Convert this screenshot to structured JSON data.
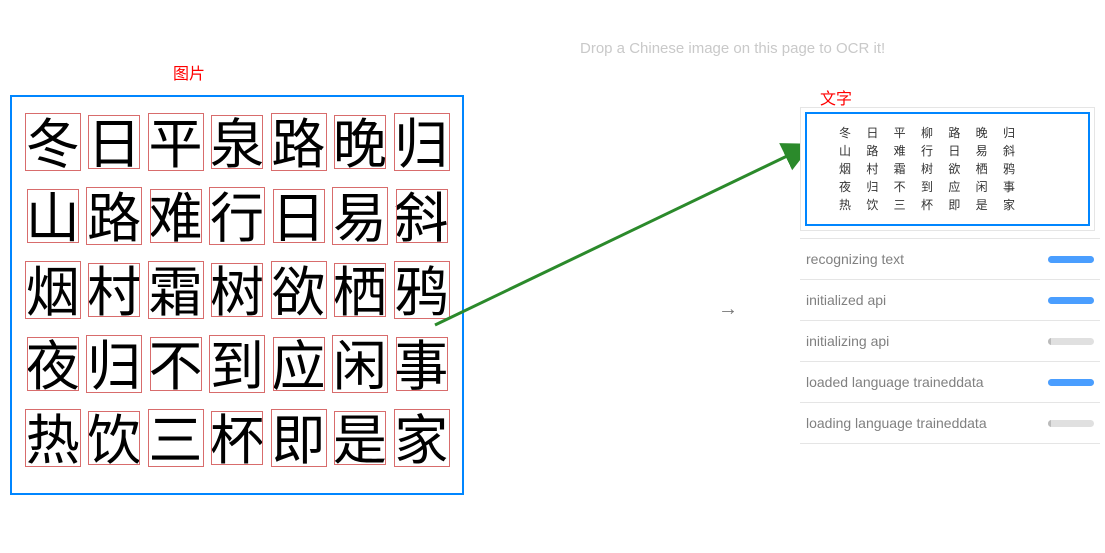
{
  "header": {
    "drop_hint": "Drop a Chinese image on this page to OCR it!"
  },
  "labels": {
    "image": "图片",
    "text": "文字"
  },
  "arrow_symbol": "→",
  "source_chars": [
    [
      "冬",
      "日",
      "平",
      "泉",
      "路",
      "晚",
      "归"
    ],
    [
      "山",
      "路",
      "难",
      "行",
      "日",
      "易",
      "斜"
    ],
    [
      "烟",
      "村",
      "霜",
      "树",
      "欲",
      "栖",
      "鸦"
    ],
    [
      "夜",
      "归",
      "不",
      "到",
      "应",
      "闲",
      "事"
    ],
    [
      "热",
      "饮",
      "三",
      "杯",
      "即",
      "是",
      "家"
    ]
  ],
  "result_lines": [
    "冬 日 平 柳 路 晚 归",
    "山 路 难 行 日 易 斜",
    "烟 村 霜 树 欲 栖 鸦",
    "夜 归 不 到 应 闲 事",
    "热 饮 三 杯 即 是 家"
  ],
  "progress": [
    {
      "label": "recognizing text",
      "state": "active"
    },
    {
      "label": "initialized api",
      "state": "active"
    },
    {
      "label": "initializing api",
      "state": "idle"
    },
    {
      "label": "loaded language traineddata",
      "state": "active"
    },
    {
      "label": "loading language traineddata",
      "state": "idle"
    }
  ]
}
